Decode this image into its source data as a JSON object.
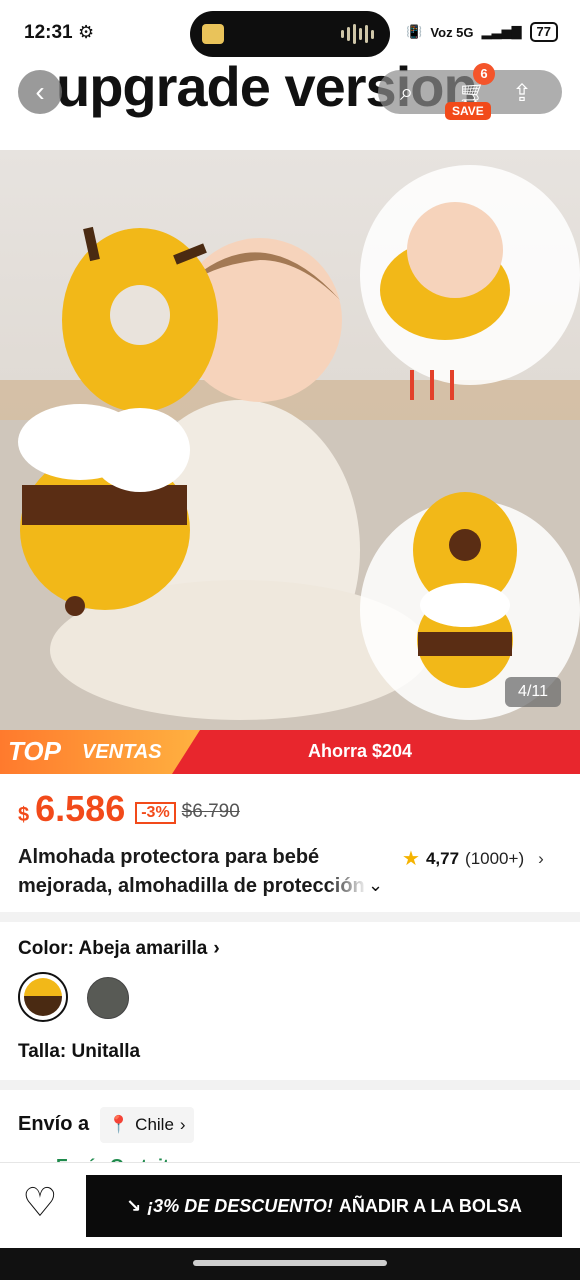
{
  "status_bar": {
    "time": "12:31",
    "right_text": "Voz 5G",
    "battery": "77",
    "settings_icon": "gear-icon"
  },
  "header": {
    "banner_text": "upgrade version",
    "cart_count": "6",
    "save_label": "SAVE",
    "icons": [
      "back-arrow-icon",
      "search-icon",
      "cart-icon",
      "share-icon"
    ]
  },
  "gallery": {
    "counter": "4/11",
    "current": 4,
    "total": 11
  },
  "promo": {
    "tag_a": "TOP",
    "tag_b": "VENTAS",
    "savings": "Ahorra $204",
    "colors": {
      "strip": "#e8262d",
      "tag": "#ff8a2e"
    }
  },
  "product": {
    "currency": "$",
    "price": "6.586",
    "discount": "-3%",
    "old_price": "$6.790",
    "title_line1": "Almohada protectora para bebé",
    "title_line2": "mejorada, almohadilla de protección",
    "rating": "4,77",
    "review_count": "(1000+)",
    "accent_color": "#f24a1a"
  },
  "options": {
    "color_label": "Color: Abeja amarilla",
    "swatches": [
      {
        "name": "Abeja amarilla",
        "selected": true,
        "color": "#f2b818"
      },
      {
        "name": "gris",
        "selected": false,
        "color": "#585a55"
      }
    ],
    "size_label": "Talla: Unitalla"
  },
  "shipping": {
    "label": "Envío a",
    "country": "Chile",
    "partial_text": "Envío Gratuito"
  },
  "bottom_bar": {
    "discount_text": "¡3% DE DESCUENTO!",
    "add_text": "AÑADIR A LA BOLSA"
  }
}
